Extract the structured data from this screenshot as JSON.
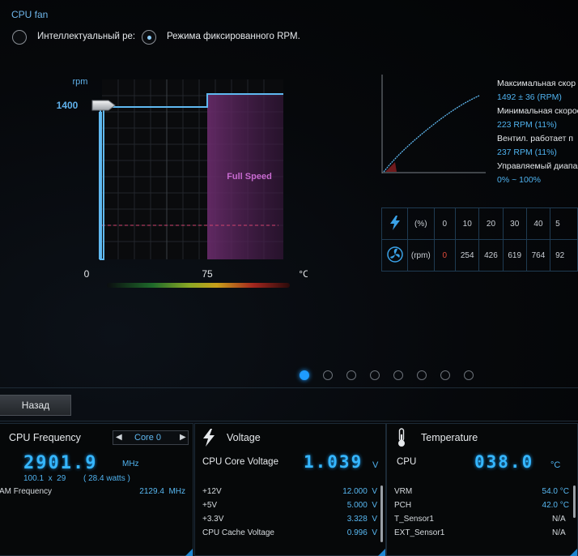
{
  "page": {
    "title": "CPU fan"
  },
  "mode": {
    "options": [
      {
        "label": "Интеллектуальный ре:",
        "selected": false
      },
      {
        "label": "Режима фиксированного RPM.",
        "selected": true
      }
    ]
  },
  "fan_chart": {
    "rpm_label": "rpm",
    "rpm_value": "1400",
    "zero_label": "0",
    "temp_label": "75",
    "unit_label": "°C",
    "zone_label": "Full Speed"
  },
  "stats": {
    "max_label": "Максимальная скор",
    "max_value": "1492 ± 36 (RPM)",
    "min_label": "Минимальная скорос",
    "min_value": "223 RPM (11%)",
    "stop_label": "Вентил. работает п",
    "stop_value": "237 RPM (11%)",
    "range_label": "Управляемый диапа",
    "range_value": "0% ~ 100%"
  },
  "speed_table": {
    "percent_unit": "(%)",
    "rpm_unit": "(rpm)",
    "percents": [
      "0",
      "10",
      "20",
      "30",
      "40",
      "5"
    ],
    "rpms": [
      "0",
      "254",
      "426",
      "619",
      "764",
      "92"
    ]
  },
  "pager": {
    "count": 8,
    "active": 0
  },
  "back_button": "Назад",
  "cpu_frequency": {
    "title": "CPU Frequency",
    "core": "Core 0",
    "value": "2901.9",
    "unit": "MHz",
    "ratio": "100.1  x  29",
    "power": "( 28.4 watts )",
    "dram_label": "AM Frequency",
    "dram_value": "2129.4  MHz"
  },
  "voltage": {
    "title": "Voltage",
    "main_label": "CPU Core Voltage",
    "main_value": "1.039",
    "main_unit": "V",
    "rows": [
      {
        "label": "+12V",
        "value": "12.000  V"
      },
      {
        "label": "+5V",
        "value": "5.000  V"
      },
      {
        "label": "+3.3V",
        "value": "3.328  V"
      },
      {
        "label": "CPU Cache Voltage",
        "value": "0.996  V"
      }
    ]
  },
  "temperature": {
    "title": "Temperature",
    "main_label": "CPU",
    "main_value": "038.0",
    "main_unit": "°C",
    "rows": [
      {
        "label": "VRM",
        "value": "54.0 °C"
      },
      {
        "label": "PCH",
        "value": "42.0 °C"
      },
      {
        "label": "T_Sensor1",
        "value": "N/A"
      },
      {
        "label": "EXT_Sensor1",
        "value": "N/A"
      }
    ]
  },
  "colors": {
    "accent": "#35b6ff",
    "zone": "#b04fb3",
    "line": "#5fb8f0"
  }
}
